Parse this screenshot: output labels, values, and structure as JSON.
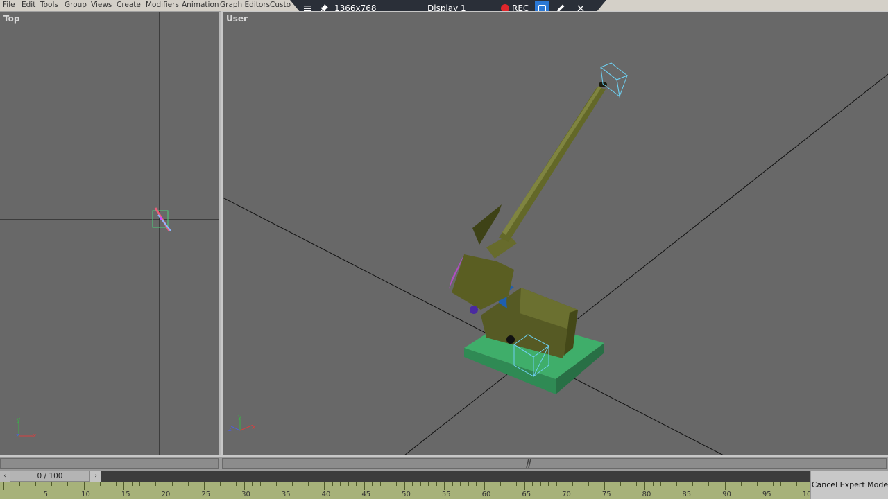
{
  "menu": {
    "items": [
      "File",
      "Edit",
      "Tools",
      "Group",
      "Views",
      "Create",
      "Modifiers",
      "Animation",
      "Graph Editors",
      "Custo"
    ]
  },
  "remote_toolbar": {
    "resolution": "1366x768",
    "display": "Display 1",
    "rec_label": "REC",
    "icons": [
      "menu-icon",
      "pin-icon",
      "record-icon",
      "window-icon",
      "pencil-icon",
      "close-icon"
    ]
  },
  "viewports": {
    "top": {
      "label": "Top"
    },
    "user": {
      "label": "User"
    }
  },
  "axes": {
    "x": "x",
    "y": "y",
    "z": "z"
  },
  "timeline": {
    "frame_display": "0 / 100",
    "prev_icon": "‹",
    "next_icon": "›",
    "ruler_labels": [
      "5",
      "10",
      "15",
      "20",
      "25",
      "30",
      "35",
      "40",
      "45",
      "50",
      "55",
      "60",
      "65",
      "70",
      "75",
      "80",
      "85",
      "90",
      "95",
      "10"
    ]
  },
  "expert_mode": {
    "cancel_label": "Cancel Expert Mode"
  },
  "colors": {
    "viewport_bg": "#686868",
    "gun": "#5c6128",
    "base_plate": "#3fae6a",
    "bounding_box": "#6ecff0",
    "rec": "#e0262b",
    "ruler": "#a7b27a"
  }
}
